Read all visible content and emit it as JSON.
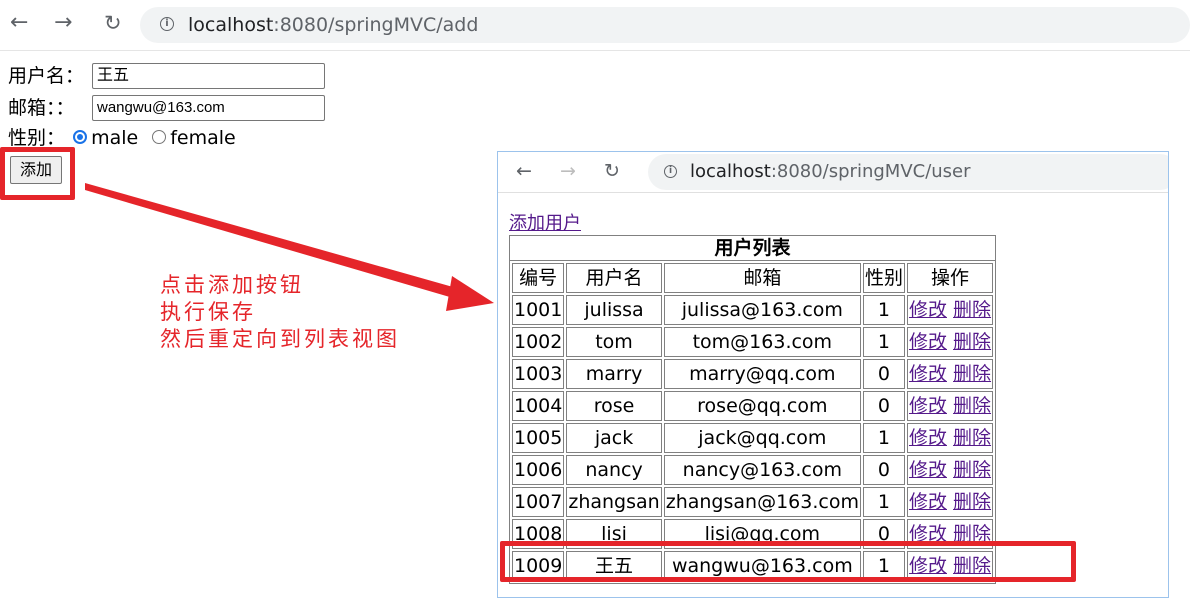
{
  "browser": {
    "url_host": "localhost",
    "url_path": ":8080/springMVC/add"
  },
  "form": {
    "username_label": "用户名：",
    "username_value": "王五",
    "email_label": "邮箱：：",
    "email_value": "wangwu@163.com",
    "gender_label": "性别：",
    "gender_options": [
      "male",
      "female"
    ],
    "gender_selected": "male",
    "submit_label": "添加"
  },
  "annotation": {
    "lines": [
      "点击添加按钮",
      "执行保存",
      "然后重定向到列表视图"
    ],
    "color": "#e5252a"
  },
  "inner_browser": {
    "url_host": "localhost",
    "url_path": ":8080/springMVC/user",
    "add_user_link": "添加用户",
    "table": {
      "caption": "用户列表",
      "headers": [
        "编号",
        "用户名",
        "邮箱",
        "性别",
        "操作"
      ],
      "edit_label": "修改",
      "delete_label": "删除",
      "rows": [
        [
          "1001",
          "julissa",
          "julissa@163.com",
          "1"
        ],
        [
          "1002",
          "tom",
          "tom@163.com",
          "1"
        ],
        [
          "1003",
          "marry",
          "marry@qq.com",
          "0"
        ],
        [
          "1004",
          "rose",
          "rose@qq.com",
          "0"
        ],
        [
          "1005",
          "jack",
          "jack@qq.com",
          "1"
        ],
        [
          "1006",
          "nancy",
          "nancy@163.com",
          "0"
        ],
        [
          "1007",
          "zhangsan",
          "zhangsan@163.com",
          "1"
        ],
        [
          "1008",
          "lisi",
          "lisi@qq.com",
          "0"
        ],
        [
          "1009",
          "王五",
          "wangwu@163.com",
          "1"
        ]
      ]
    }
  },
  "icons": [
    "back-arrow-icon",
    "forward-arrow-icon",
    "reload-icon",
    "info-icon"
  ]
}
